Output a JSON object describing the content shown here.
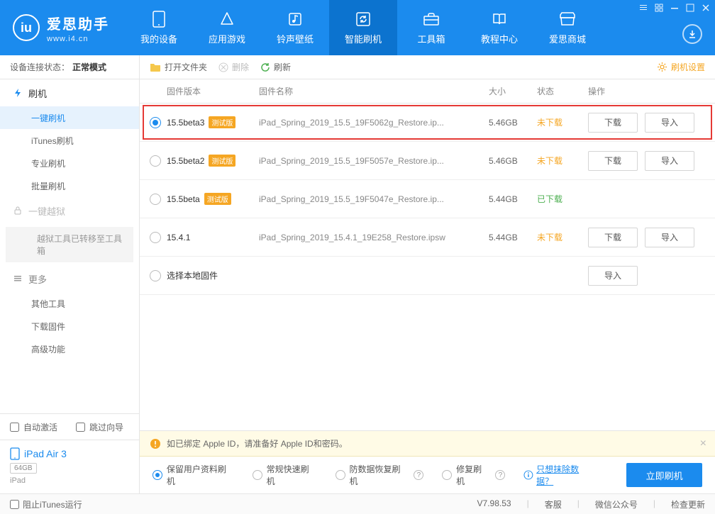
{
  "logo": {
    "text": "爱思助手",
    "sub": "www.i4.cn"
  },
  "nav": [
    {
      "label": "我的设备"
    },
    {
      "label": "应用游戏"
    },
    {
      "label": "铃声壁纸"
    },
    {
      "label": "智能刷机"
    },
    {
      "label": "工具箱"
    },
    {
      "label": "教程中心"
    },
    {
      "label": "爱思商城"
    }
  ],
  "conn": {
    "label": "设备连接状态：",
    "value": "正常模式"
  },
  "sidebar": {
    "flash_group": "刷机",
    "subs": [
      "一键刷机",
      "iTunes刷机",
      "专业刷机",
      "批量刷机"
    ],
    "jailbreak": "一键越狱",
    "jb_note": "越狱工具已转移至工具箱",
    "more": "更多",
    "more_subs": [
      "其他工具",
      "下载固件",
      "高级功能"
    ],
    "auto_activate": "自动激活",
    "skip_guide": "跳过向导",
    "device_name": "iPad Air 3",
    "device_cap": "64GB",
    "device_model": "iPad"
  },
  "toolbar": {
    "open": "打开文件夹",
    "delete": "删除",
    "refresh": "刷新",
    "settings": "刷机设置"
  },
  "columns": {
    "version": "固件版本",
    "name": "固件名称",
    "size": "大小",
    "status": "状态",
    "ops": "操作"
  },
  "status_labels": {
    "not": "未下载",
    "done": "已下载"
  },
  "btn": {
    "download": "下载",
    "import": "导入"
  },
  "rows": [
    {
      "version": "15.5beta3",
      "beta": "测试版",
      "name": "iPad_Spring_2019_15.5_19F5062g_Restore.ip...",
      "size": "5.46GB",
      "status": "not",
      "checked": true,
      "highlighted": true,
      "download": true,
      "import": true
    },
    {
      "version": "15.5beta2",
      "beta": "测试版",
      "name": "iPad_Spring_2019_15.5_19F5057e_Restore.ip...",
      "size": "5.46GB",
      "status": "not",
      "checked": false,
      "download": true,
      "import": true
    },
    {
      "version": "15.5beta",
      "beta": "测试版",
      "name": "iPad_Spring_2019_15.5_19F5047e_Restore.ip...",
      "size": "5.44GB",
      "status": "done",
      "checked": false,
      "download": false,
      "import": false
    },
    {
      "version": "15.4.1",
      "beta": "",
      "name": "iPad_Spring_2019_15.4.1_19E258_Restore.ipsw",
      "size": "5.44GB",
      "status": "not",
      "checked": false,
      "download": true,
      "import": true
    }
  ],
  "local_row": {
    "label": "选择本地固件"
  },
  "info_bar": "如已绑定 Apple ID，请准备好 Apple ID和密码。",
  "flash_opts": {
    "keep": "保留用户资料刷机",
    "fast": "常规快速刷机",
    "antirec": "防数据恢复刷机",
    "repair": "修复刷机",
    "erase": "只想抹除数据？",
    "go": "立即刷机"
  },
  "statusbar": {
    "block_itunes": "阻止iTunes运行",
    "version": "V7.98.53",
    "support": "客服",
    "wechat": "微信公众号",
    "update": "检查更新"
  }
}
